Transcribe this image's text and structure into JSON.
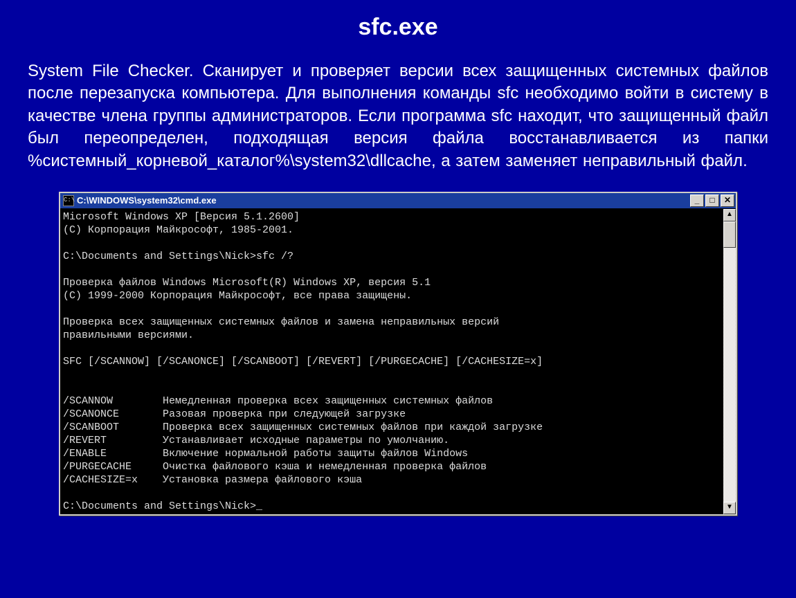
{
  "slide": {
    "title": "sfc.exe",
    "body": "System File Checker. Сканирует и проверяет версии всех защищенных системных файлов после перезапуска компьютера. Для выполнения команды sfc необходимо войти в систему в качестве члена группы администраторов. Если программа sfc находит, что защищенный файл был переопределен, подходящая версия файла восстанавливается из папки %системный_корневой_каталог%\\system32\\dllcache, а затем заменяет неправильный файл."
  },
  "console": {
    "icon_glyph": "C:\\",
    "title": "C:\\WINDOWS\\system32\\cmd.exe",
    "buttons": {
      "min": "_",
      "max": "□",
      "close": "✕"
    },
    "scroll": {
      "up": "▲",
      "down": "▼"
    },
    "lines": [
      "Microsoft Windows XP [Версия 5.1.2600]",
      "(C) Корпорация Майкрософт, 1985-2001.",
      "",
      "C:\\Documents and Settings\\Nick>sfc /?",
      "",
      "Проверка файлов Windows Microsoft(R) Windows XP, версия 5.1",
      "(C) 1999-2000 Корпорация Майкрософт, все права защищены.",
      "",
      "Проверка всех защищенных системных файлов и замена неправильных версий",
      "правильными версиями.",
      "",
      "SFC [/SCANNOW] [/SCANONCE] [/SCANBOOT] [/REVERT] [/PURGECACHE] [/CACHESIZE=x]",
      "",
      "",
      "/SCANNOW        Немедленная проверка всех защищенных системных файлов",
      "/SCANONCE       Разовая проверка при следующей загрузке",
      "/SCANBOOT       Проверка всех защищенных системных файлов при каждой загрузке",
      "/REVERT         Устанавливает исходные параметры по умолчанию.",
      "/ENABLE         Включение нормальной работы защиты файлов Windows",
      "/PURGECACHE     Очистка файлового кэша и немедленная проверка файлов",
      "/CACHESIZE=x    Установка размера файлового кэша",
      "",
      "C:\\Documents and Settings\\Nick>_"
    ]
  }
}
